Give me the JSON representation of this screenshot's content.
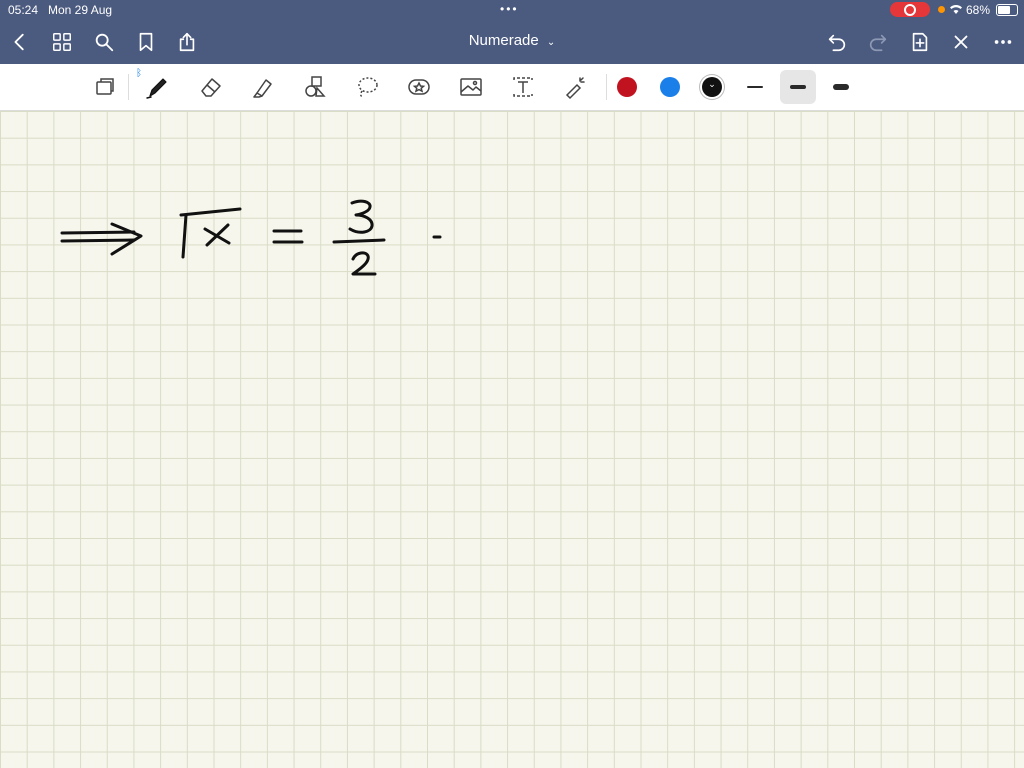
{
  "status": {
    "time": "05:24",
    "date": "Mon 29 Aug",
    "battery": "68%"
  },
  "header": {
    "title": "Numerade",
    "dropdown_icon": "chevron-down-icon"
  },
  "nav_icons": [
    "back-icon",
    "grid-icon",
    "search-icon",
    "bookmark-icon",
    "share-icon",
    "undo-icon",
    "redo-icon",
    "add-page-icon",
    "close-icon",
    "more-icon"
  ],
  "toolbar": {
    "tools": [
      "pages-icon",
      "pen-icon",
      "eraser-icon",
      "highlighter-icon",
      "shapes-icon",
      "lasso-icon",
      "sticker-icon",
      "image-icon",
      "text-icon",
      "laser-icon"
    ],
    "colors": [
      "#c1121f",
      "#1a7fe8",
      "#111111"
    ],
    "stroke_sizes": [
      "thin",
      "medium",
      "thick"
    ],
    "active_stroke": "medium"
  },
  "colors": {
    "header": "#4b5a7f",
    "paper": "#f7f6ec",
    "grid": "#d9dcc6",
    "ink": "#111111"
  }
}
